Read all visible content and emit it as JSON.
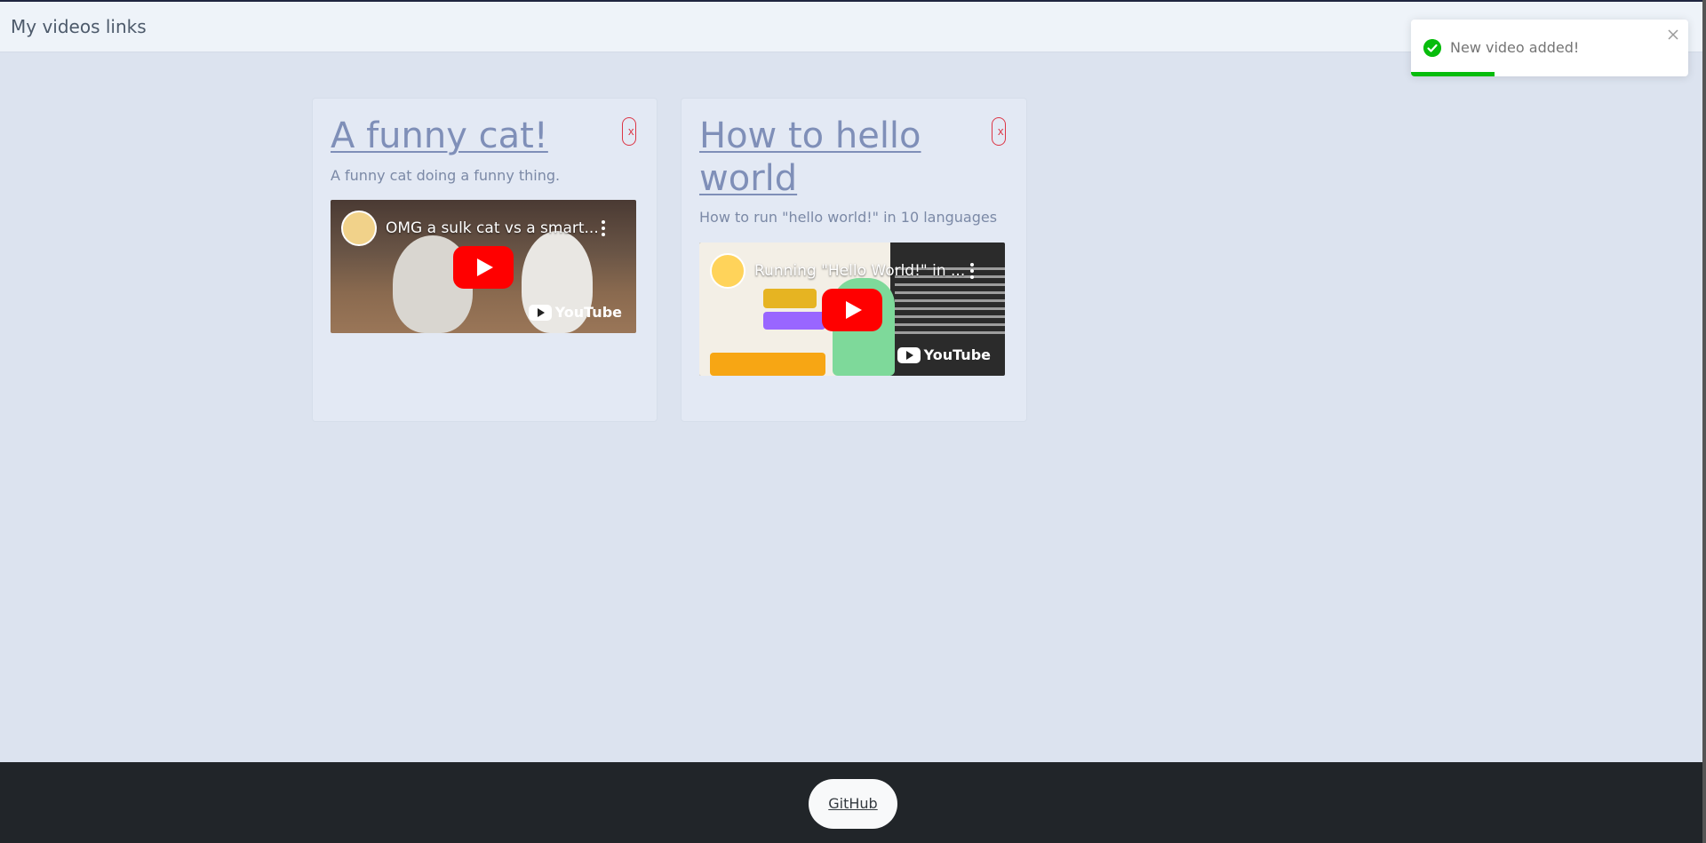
{
  "navbar": {
    "brand": "My videos links"
  },
  "cards": [
    {
      "title": "A funny cat!",
      "description": "A funny cat doing a funny thing.",
      "delete_label": "x",
      "video": {
        "title": "OMG a sulk cat vs a smart...",
        "brand": "YouTube"
      }
    },
    {
      "title": "How to hello world",
      "description": "How to run \"hello world!\" in 10 languages",
      "delete_label": "x",
      "video": {
        "title": "Running \"Hello World!\" in ...",
        "brand": "YouTube"
      }
    }
  ],
  "footer": {
    "github_label": "GitHub"
  },
  "toast": {
    "message": "New video added!",
    "progress": 0.3
  },
  "colors": {
    "success": "#07bc0c",
    "danger": "#dc3545",
    "footer": "#212529",
    "youtube_red": "#ff0000"
  },
  "icons": [
    "check-circle-icon",
    "close-icon",
    "play-icon",
    "more-vert-icon",
    "youtube-logo-icon"
  ]
}
